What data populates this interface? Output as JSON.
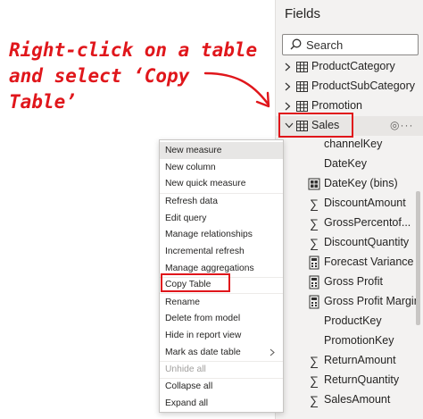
{
  "annotation": {
    "lines": [
      "Right-click on a table",
      "and select ‘Copy",
      "Table’"
    ],
    "color": "#e0161b"
  },
  "fields_pane": {
    "title": "Fields",
    "search_placeholder": "Search",
    "search_icon": "search-icon",
    "tables": [
      {
        "label": "ProductCategory",
        "state": "collapsed"
      },
      {
        "label": "ProductSubCategory",
        "state": "collapsed"
      },
      {
        "label": "Promotion",
        "state": "collapsed"
      },
      {
        "label": "Sales",
        "state": "expanded",
        "highlighted": true
      }
    ],
    "sales_actions": "◎···",
    "sales_fields": [
      {
        "label": "channelKey",
        "icon": "none"
      },
      {
        "label": "DateKey",
        "icon": "none"
      },
      {
        "label": "DateKey (bins)",
        "icon": "bins-icon"
      },
      {
        "label": "DiscountAmount",
        "icon": "sigma-icon"
      },
      {
        "label": "GrossPercentof...",
        "icon": "sigma-icon"
      },
      {
        "label": "DiscountQuantity",
        "icon": "sigma-icon"
      },
      {
        "label": "Forecast Variance",
        "icon": "calculator-icon"
      },
      {
        "label": "Gross Profit",
        "icon": "calculator-icon"
      },
      {
        "label": "Gross Profit Margin",
        "icon": "calculator-icon"
      },
      {
        "label": "ProductKey",
        "icon": "none"
      },
      {
        "label": "PromotionKey",
        "icon": "none"
      },
      {
        "label": "ReturnAmount",
        "icon": "sigma-icon"
      },
      {
        "label": "ReturnQuantity",
        "icon": "sigma-icon"
      },
      {
        "label": "SalesAmount",
        "icon": "sigma-icon"
      }
    ]
  },
  "context_menu": {
    "items": [
      {
        "label": "New measure"
      },
      {
        "label": "New column"
      },
      {
        "label": "New quick measure"
      },
      {
        "label": "Refresh data"
      },
      {
        "label": "Edit query"
      },
      {
        "label": "Manage relationships"
      },
      {
        "label": "Incremental refresh"
      },
      {
        "label": "Manage aggregations"
      },
      {
        "label": "Copy Table",
        "highlighted": true
      },
      {
        "label": "Rename"
      },
      {
        "label": "Delete from model"
      },
      {
        "label": "Hide in report view"
      },
      {
        "label": "Mark as date table",
        "submenu": true
      },
      {
        "label": "Unhide all",
        "disabled": true
      },
      {
        "label": "Collapse all"
      },
      {
        "label": "Expand all"
      }
    ]
  },
  "colors": {
    "accent_red": "#e0161b",
    "pane_bg": "#f3f2f1",
    "menu_bg": "#ffffff"
  }
}
